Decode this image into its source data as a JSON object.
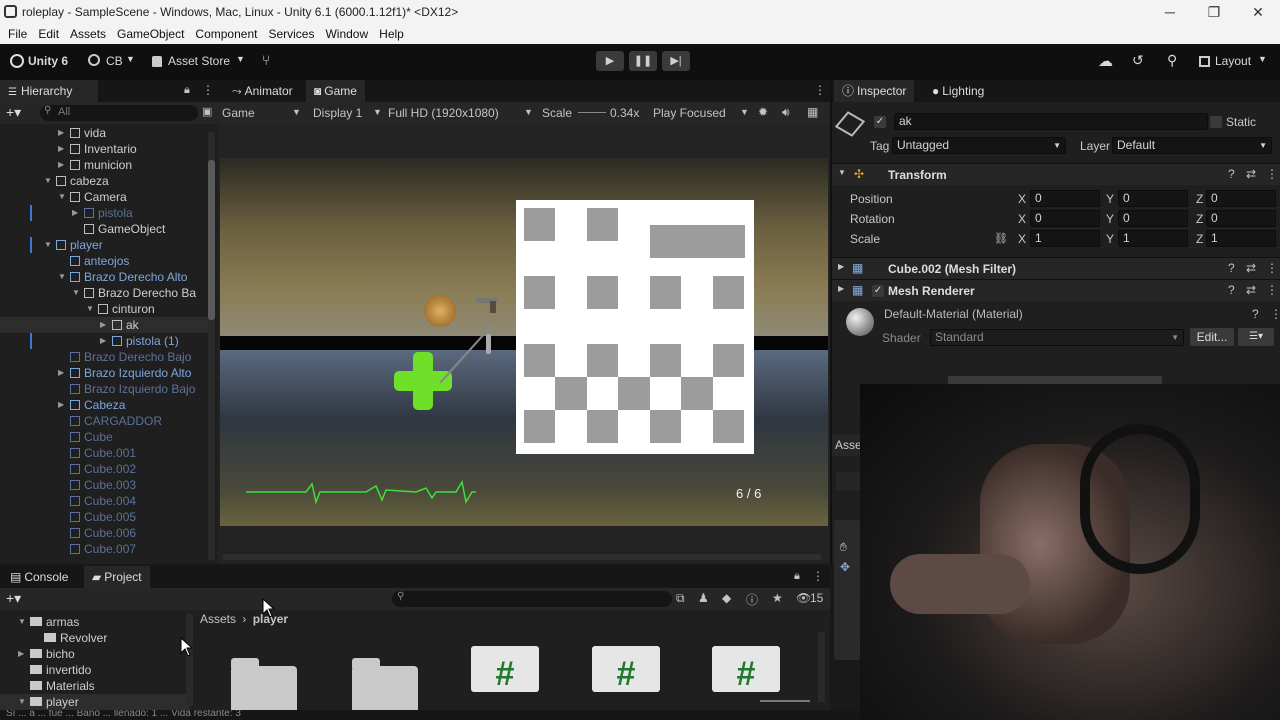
{
  "window": {
    "title": "roleplay - SampleScene - Windows, Mac, Linux - Unity 6.1 (6000.1.12f1)* <DX12>",
    "controls": [
      "─",
      "❐",
      "✕"
    ]
  },
  "menubar": [
    "File",
    "Edit",
    "Assets",
    "GameObject",
    "Component",
    "Services",
    "Window",
    "Help"
  ],
  "toolbar": {
    "unity": "Unity 6",
    "account": "CB",
    "asset_store": "Asset Store",
    "layout": "Layout"
  },
  "hierarchy": {
    "tab": "Hierarchy",
    "search_placeholder": "All",
    "rows": [
      {
        "label": "vida"
      },
      {
        "label": "Inventario"
      },
      {
        "label": "municion"
      },
      {
        "label": "cabeza"
      },
      {
        "label": "Camera"
      },
      {
        "label": "pistola"
      },
      {
        "label": "GameObject"
      },
      {
        "label": "player"
      },
      {
        "label": "anteojos"
      },
      {
        "label": "Brazo Derecho Alto"
      },
      {
        "label": "Brazo Derecho Ba"
      },
      {
        "label": "cinturon"
      },
      {
        "label": "ak"
      },
      {
        "label": "pistola (1)"
      },
      {
        "label": "Brazo Derecho Bajo"
      },
      {
        "label": "Brazo Izquierdo Alto"
      },
      {
        "label": "Brazo Izquierdo Bajo"
      },
      {
        "label": "Cabeza"
      },
      {
        "label": "CARGADDOR"
      },
      {
        "label": "Cube"
      },
      {
        "label": "Cube.001"
      },
      {
        "label": "Cube.002"
      },
      {
        "label": "Cube.003"
      },
      {
        "label": "Cube.004"
      },
      {
        "label": "Cube.005"
      },
      {
        "label": "Cube.006"
      },
      {
        "label": "Cube.007"
      }
    ]
  },
  "game": {
    "tabs": [
      "Animator",
      "Game"
    ],
    "mode": "Game",
    "display": "Display 1",
    "resolution": "Full HD (1920x1080)",
    "scale_label": "Scale",
    "scale_value": "0.34x",
    "play_mode": "Play Focused",
    "ammo": "6 / 6"
  },
  "inspector": {
    "tabs": [
      "Inspector",
      "Lighting"
    ],
    "object_name": "ak",
    "static": "Static",
    "tag_label": "Tag",
    "tag_value": "Untagged",
    "layer_label": "Layer",
    "layer_value": "Default",
    "transform": {
      "title": "Transform",
      "position": {
        "label": "Position",
        "x": "0",
        "y": "0",
        "z": "0"
      },
      "rotation": {
        "label": "Rotation",
        "x": "0",
        "y": "0",
        "z": "0"
      },
      "scale": {
        "label": "Scale",
        "x": "1",
        "y": "1",
        "z": "1"
      }
    },
    "mesh_filter": "Cube.002 (Mesh Filter)",
    "mesh_renderer": "Mesh Renderer",
    "material": "Default-Material (Material)",
    "shader_label": "Shader",
    "shader_value": "Standard",
    "edit_button": "Edit...",
    "assets_tab": "Asse"
  },
  "project": {
    "tabs": [
      "Console",
      "Project"
    ],
    "tree": [
      "armas",
      "Revolver",
      "bicho",
      "invertido",
      "Materials",
      "player"
    ],
    "breadcrumb": [
      "Assets",
      "player"
    ],
    "count": "15"
  },
  "status": "Sí ... a ... fué ... Baño ... llenado: 1 ... Vida restante: 3"
}
